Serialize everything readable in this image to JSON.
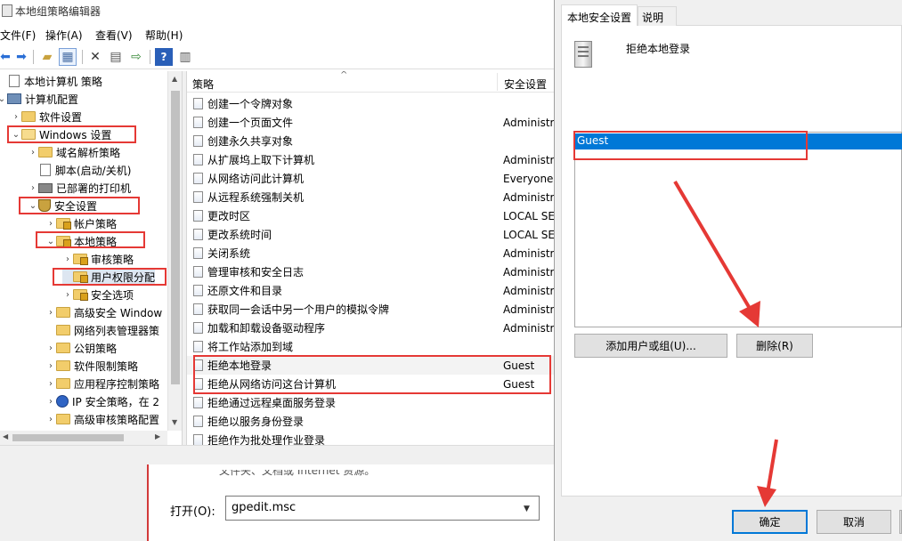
{
  "window": {
    "title": "本地组策略编辑器"
  },
  "menu": [
    "文件(F)",
    "操作(A)",
    "查看(V)",
    "帮助(H)"
  ],
  "toolbar": {
    "icons": [
      "back-arrow-icon",
      "forward-arrow-icon",
      "up-folder-icon",
      "show-hide-tree-icon",
      "delete-icon",
      "properties-icon",
      "export-icon",
      "help-icon",
      "view-icon"
    ]
  },
  "tree": {
    "items": [
      {
        "label": "本地计算机 策略",
        "indent": 0,
        "arrow": "",
        "icon": "doc"
      },
      {
        "label": "计算机配置",
        "indent": 1,
        "arrow": "⌄",
        "icon": "pc"
      },
      {
        "label": "软件设置",
        "indent": 2,
        "arrow": "›",
        "icon": "folder"
      },
      {
        "label": "Windows 设置",
        "indent": 2,
        "arrow": "⌄",
        "icon": "folder-open"
      },
      {
        "label": "域名解析策略",
        "indent": 3,
        "arrow": "›",
        "icon": "folder"
      },
      {
        "label": "脚本(启动/关机)",
        "indent": 3,
        "arrow": "",
        "icon": "doc"
      },
      {
        "label": "已部署的打印机",
        "indent": 3,
        "arrow": "›",
        "icon": "printer"
      },
      {
        "label": "安全设置",
        "indent": 3,
        "arrow": "⌄",
        "icon": "shield"
      },
      {
        "label": "帐户策略",
        "indent": 4,
        "arrow": "›",
        "icon": "folder-lock"
      },
      {
        "label": "本地策略",
        "indent": 4,
        "arrow": "⌄",
        "icon": "folder-lock"
      },
      {
        "label": "审核策略",
        "indent": 5,
        "arrow": "›",
        "icon": "folder-lock"
      },
      {
        "label": "用户权限分配",
        "indent": 5,
        "arrow": "",
        "icon": "folder-lock",
        "selected": true
      },
      {
        "label": "安全选项",
        "indent": 5,
        "arrow": "›",
        "icon": "folder-lock"
      },
      {
        "label": "高级安全 Window",
        "indent": 4,
        "arrow": "›",
        "icon": "folder"
      },
      {
        "label": "网络列表管理器策",
        "indent": 4,
        "arrow": "",
        "icon": "folder"
      },
      {
        "label": "公钥策略",
        "indent": 4,
        "arrow": "›",
        "icon": "folder"
      },
      {
        "label": "软件限制策略",
        "indent": 4,
        "arrow": "›",
        "icon": "folder"
      },
      {
        "label": "应用程序控制策略",
        "indent": 4,
        "arrow": "›",
        "icon": "folder"
      },
      {
        "label": "IP 安全策略，在 2",
        "indent": 4,
        "arrow": "›",
        "icon": "ip"
      },
      {
        "label": "高级审核策略配置",
        "indent": 4,
        "arrow": "›",
        "icon": "folder"
      }
    ]
  },
  "list": {
    "header": {
      "policy": "策略",
      "setting": "安全设置"
    },
    "rows": [
      {
        "policy": "创建一个令牌对象",
        "setting": ""
      },
      {
        "policy": "创建一个页面文件",
        "setting": "Administr"
      },
      {
        "policy": "创建永久共享对象",
        "setting": ""
      },
      {
        "policy": "从扩展坞上取下计算机",
        "setting": "Administr"
      },
      {
        "policy": "从网络访问此计算机",
        "setting": "Everyone,"
      },
      {
        "policy": "从远程系统强制关机",
        "setting": "Administr"
      },
      {
        "policy": "更改时区",
        "setting": "LOCAL SE"
      },
      {
        "policy": "更改系统时间",
        "setting": "LOCAL SE"
      },
      {
        "policy": "关闭系统",
        "setting": "Administr"
      },
      {
        "policy": "管理审核和安全日志",
        "setting": "Administr"
      },
      {
        "policy": "还原文件和目录",
        "setting": "Administr"
      },
      {
        "policy": "获取同一会话中另一个用户的模拟令牌",
        "setting": "Administr"
      },
      {
        "policy": "加载和卸载设备驱动程序",
        "setting": "Administr"
      },
      {
        "policy": "将工作站添加到域",
        "setting": ""
      },
      {
        "policy": "拒绝本地登录",
        "setting": "Guest"
      },
      {
        "policy": "拒绝从网络访问这台计算机",
        "setting": "Guest"
      },
      {
        "policy": "拒绝通过远程桌面服务登录",
        "setting": ""
      },
      {
        "policy": "拒绝以服务身份登录",
        "setting": ""
      },
      {
        "policy": "拒绝作为批处理作业登录",
        "setting": ""
      }
    ]
  },
  "run_dialog": {
    "cut_text": "文件夹、文档或 Internet 资源。",
    "open_label": "打开(O):",
    "open_value": "gpedit.msc"
  },
  "props": {
    "tabs": [
      "本地安全设置",
      "说明"
    ],
    "policy_title": "拒绝本地登录",
    "users": [
      "Guest"
    ],
    "add_button": "添加用户或组(U)...",
    "remove_button": "删除(R)",
    "ok_button": "确定",
    "cancel_button": "取消"
  },
  "colors": {
    "highlight": "#e53935",
    "selection": "#0078d7"
  }
}
